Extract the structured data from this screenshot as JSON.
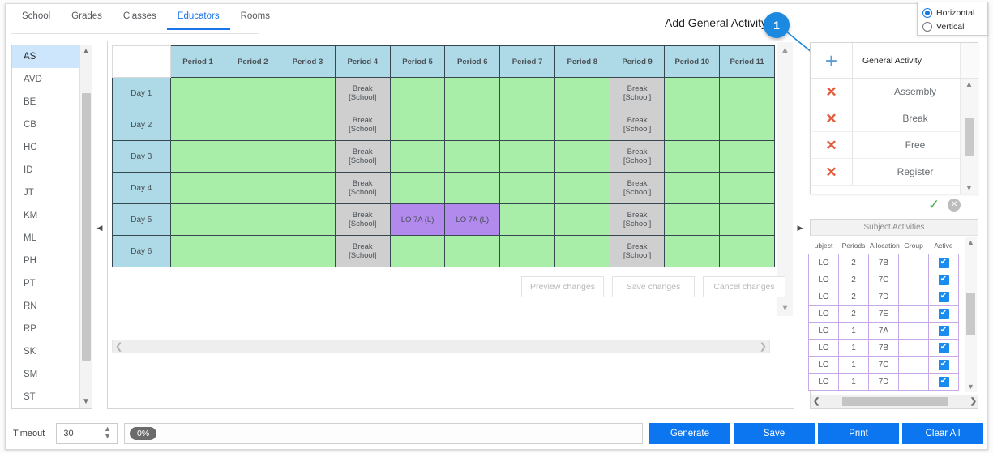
{
  "tabs": [
    {
      "label": "School",
      "active": false
    },
    {
      "label": "Grades",
      "active": false
    },
    {
      "label": "Classes",
      "active": false
    },
    {
      "label": "Educators",
      "active": true
    },
    {
      "label": "Rooms",
      "active": false
    }
  ],
  "annotation": {
    "text": "Add General Activity",
    "badge": "1"
  },
  "orientation": {
    "horizontal_label": "Horizontal",
    "vertical_label": "Vertical",
    "selected": "Horizontal"
  },
  "educators": {
    "selected": "AS",
    "items": [
      "AS",
      "AVD",
      "BE",
      "CB",
      "HC",
      "ID",
      "JT",
      "KM",
      "ML",
      "PH",
      "PT",
      "RN",
      "RP",
      "SK",
      "SM",
      "ST"
    ]
  },
  "timetable": {
    "corner_label": "",
    "periods": [
      "Period 1",
      "Period 2",
      "Period 3",
      "Period 4",
      "Period 5",
      "Period 6",
      "Period 7",
      "Period 8",
      "Period 9",
      "Period 10",
      "Period 11"
    ],
    "days": [
      "Day 1",
      "Day 2",
      "Day 3",
      "Day 4",
      "Day 5",
      "Day 6"
    ],
    "break_label": "Break\n[School]",
    "break_line1": "Break",
    "break_line2": "[School]",
    "activity_label": "LO 7A (L)",
    "cells": [
      [
        "free",
        "free",
        "free",
        "break",
        "free",
        "free",
        "free",
        "free",
        "break",
        "free",
        "free"
      ],
      [
        "free",
        "free",
        "free",
        "break",
        "free",
        "free",
        "free",
        "free",
        "break",
        "free",
        "free"
      ],
      [
        "free",
        "free",
        "free",
        "break",
        "free",
        "free",
        "free",
        "free",
        "break",
        "free",
        "free"
      ],
      [
        "free",
        "free",
        "free",
        "break",
        "free",
        "free",
        "free",
        "free",
        "break",
        "free",
        "free"
      ],
      [
        "free",
        "free",
        "free",
        "break",
        "act",
        "act",
        "free",
        "free",
        "break",
        "free",
        "free"
      ],
      [
        "free",
        "free",
        "free",
        "break",
        "free",
        "free",
        "free",
        "free",
        "break",
        "free",
        "free"
      ]
    ],
    "buttons": [
      {
        "label": "Preview changes",
        "enabled": false
      },
      {
        "label": "Save changes",
        "enabled": false
      },
      {
        "label": "Cancel changes",
        "enabled": false
      }
    ]
  },
  "general_activity": {
    "header_label": "General Activity",
    "add_icon": "plus-icon",
    "items": [
      "Assembly",
      "Break",
      "Free",
      "Register"
    ]
  },
  "subject_activities": {
    "title": "Subject Activities",
    "columns": [
      "ubject",
      "Periods",
      "Allocation",
      "Group",
      "Active"
    ],
    "rows": [
      {
        "subject": "LO",
        "periods": "2",
        "allocation": "7B",
        "group": "",
        "active": true
      },
      {
        "subject": "LO",
        "periods": "2",
        "allocation": "7C",
        "group": "",
        "active": true
      },
      {
        "subject": "LO",
        "periods": "2",
        "allocation": "7D",
        "group": "",
        "active": true
      },
      {
        "subject": "LO",
        "periods": "2",
        "allocation": "7E",
        "group": "",
        "active": true
      },
      {
        "subject": "LO",
        "periods": "1",
        "allocation": "7A",
        "group": "",
        "active": true
      },
      {
        "subject": "LO",
        "periods": "1",
        "allocation": "7B",
        "group": "",
        "active": true
      },
      {
        "subject": "LO",
        "periods": "1",
        "allocation": "7C",
        "group": "",
        "active": true
      },
      {
        "subject": "LO",
        "periods": "1",
        "allocation": "7D",
        "group": "",
        "active": true
      }
    ]
  },
  "bottom": {
    "timeout_label": "Timeout",
    "timeout_value": "30",
    "progress_value": "0%",
    "buttons": [
      "Generate",
      "Save",
      "Print",
      "Clear All"
    ]
  },
  "colors": {
    "accent_blue": "#0b76f0",
    "tab_active": "#1a73e8",
    "free_cell": "#a8eda8",
    "break_cell": "#cfcfcf",
    "activity_cell": "#b28aee",
    "header_cell": "#aed9e6",
    "delete_x": "#e05a3c",
    "check_green": "#4caf50"
  }
}
